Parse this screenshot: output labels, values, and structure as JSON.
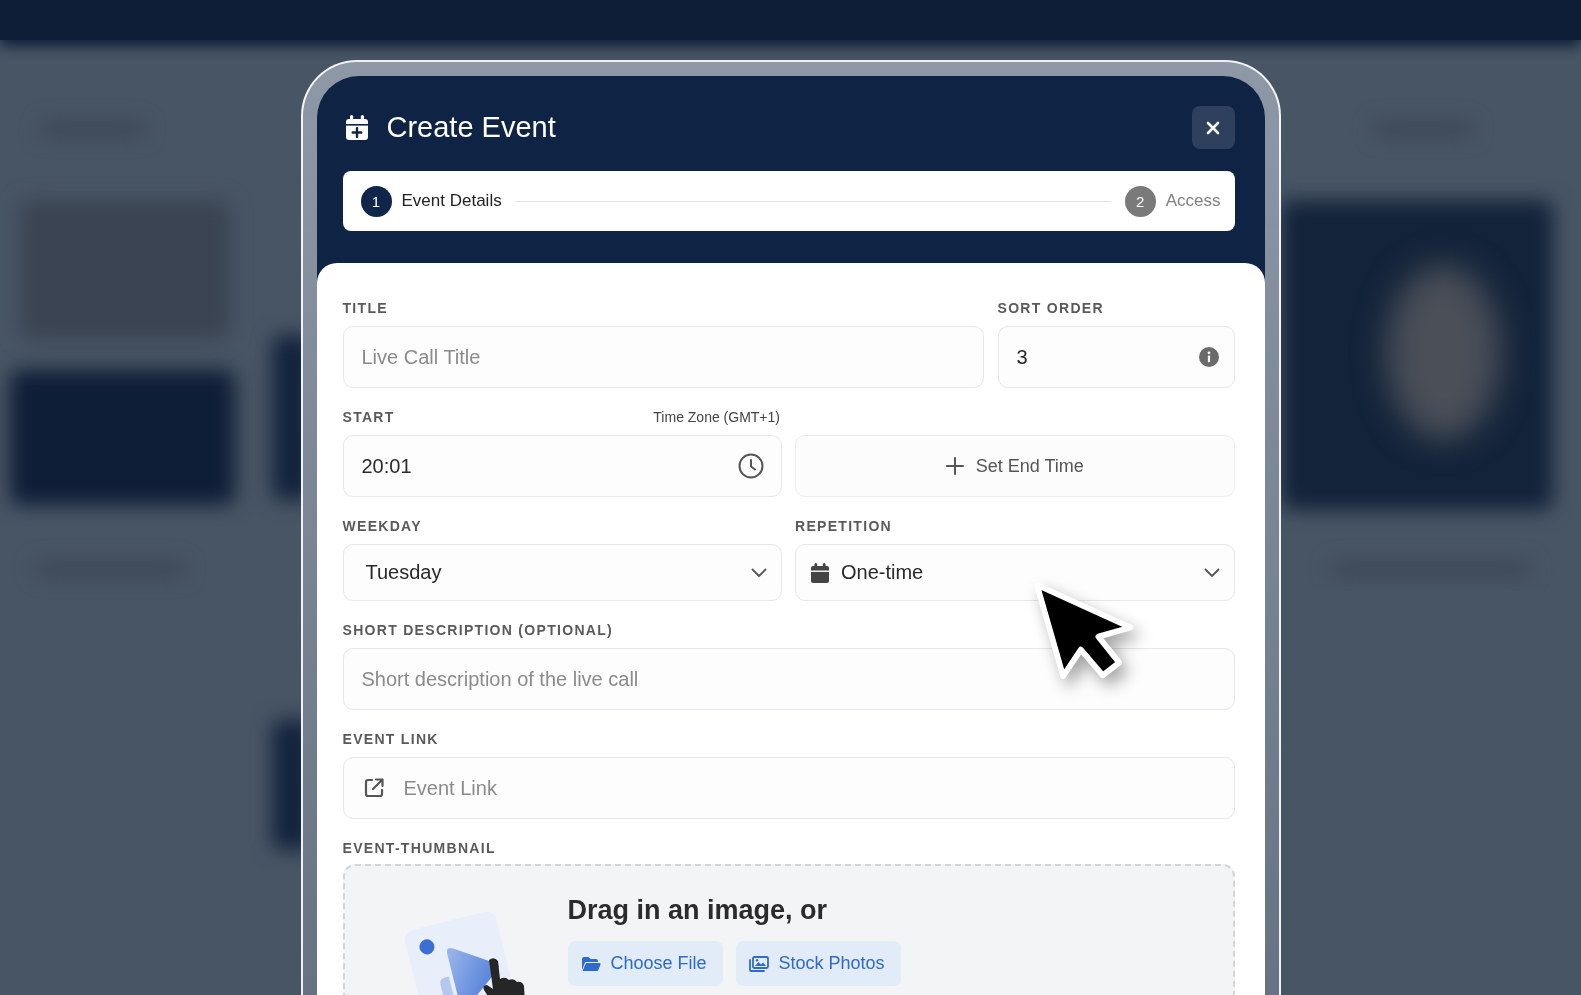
{
  "header": {
    "title": "Create Event"
  },
  "stepper": [
    {
      "number": "1",
      "label": "Event Details",
      "selected": true
    },
    {
      "number": "2",
      "label": "Access",
      "selected": false
    }
  ],
  "form": {
    "title": {
      "label": "TITLE",
      "placeholder": "Live Call Title"
    },
    "sort_order": {
      "label": "SORT ORDER",
      "value": "3"
    },
    "start": {
      "label": "START",
      "time_zone": "Time Zone (GMT+1)",
      "value": "20:01"
    },
    "end_time": {
      "label": "Set End Time"
    },
    "weekday": {
      "label": "WEEKDAY",
      "value": "Tuesday"
    },
    "repetition": {
      "label": "REPETITION",
      "value": "One-time"
    },
    "short_description": {
      "label": "SHORT DESCRIPTION (OPTIONAL)",
      "placeholder": "Short description of the live call"
    },
    "event_link": {
      "label": "EVENT LINK",
      "placeholder": "Event Link"
    },
    "thumbnail": {
      "label": "EVENT-THUMBNAIL",
      "prompt": "Drag in an image, or",
      "buttons": [
        {
          "kind": "folder",
          "label": "Choose File"
        },
        {
          "kind": "gallery",
          "label": "Stock Photos"
        }
      ]
    }
  }
}
